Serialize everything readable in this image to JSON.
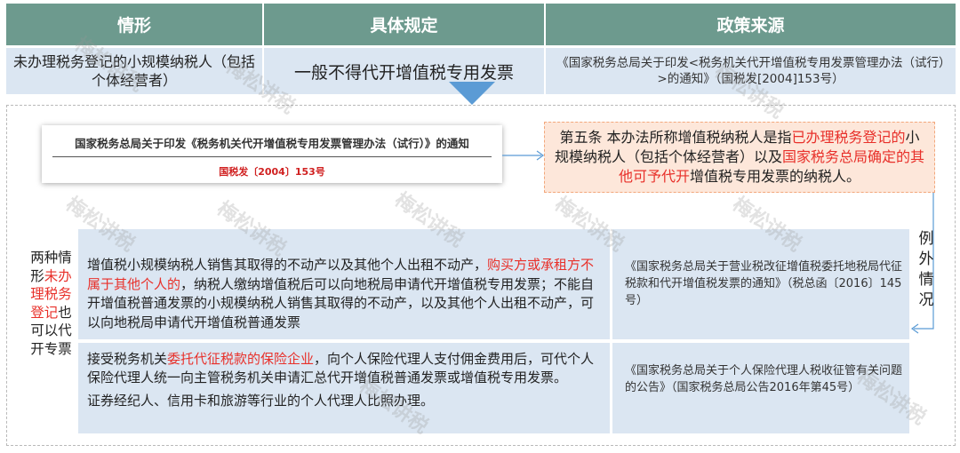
{
  "table": {
    "headers": [
      "情形",
      "具体规定",
      "政策来源"
    ],
    "row": {
      "situation": "未办理税务登记的小规模纳税人（包括个体经营者）",
      "rule": "一般不得代开增值税专用发票",
      "source": "《国家税务总局关于印发<税务机关代开增值税专用发票管理办法（试行）>的通知》（国税发[2004]153号）"
    }
  },
  "notice": {
    "title": "国家税务总局关于印发《税务机关代开增值税专用发票管理办法（试行）》的通知",
    "doc_no": "国税发〔2004〕153号"
  },
  "article5": {
    "prefix": "第五条 本办法所称增值税纳税人是指",
    "red1": "已办理税务登记的",
    "mid": "小规模纳税人（包括个体经营者）以及",
    "red2": "国家税务总局确定的其他可予代开",
    "suffix": "增值税专用发票的纳税人。"
  },
  "left_label": {
    "part1": "两种情形",
    "red": "未办理税务登记",
    "part2": "也可以代开专票"
  },
  "cases": [
    {
      "text_a": "增值税小规模纳税人销售其取得的不动产以及其他个人出租不动产，",
      "text_red": "购买方或承租方不属于其他个人的",
      "text_b": "，纳税人缴纳增值税后可以向地税局申请代开增值税专用发票；不能自开增值税普通发票的小规模纳税人销售其取得的不动产，以及其他个人出租不动产，可以向地税局申请代开增值税普通发票",
      "source": "《国家税务总局关于营业税改征增值税委托地税局代征税款和代开增值税发票的通知》（税总函〔2016〕145号）"
    },
    {
      "text_a": "接受税务机关",
      "text_red": "委托代征税款的保险企业",
      "text_b": "，向个人保险代理人支付佣金费用后，可代个人保险代理人统一向主管税务机关申请汇总代开增值税普通发票或增值税专用发票。",
      "text_c": "证券经纪人、信用卡和旅游等行业的个人代理人比照办理。",
      "source": "《国家税务总局关于个人保险代理人税收征管有关问题的公告》（国家税务总局公告2016年第45号）"
    }
  ],
  "exception": "例外情况",
  "watermark": "梅松讲税",
  "colors": {
    "header_bg": "#6d9a8e",
    "row_bg": "#dbe6f2",
    "highlight_red": "#e8302a",
    "article_bg": "#fde7da",
    "arrow": "#5b9bd5"
  }
}
